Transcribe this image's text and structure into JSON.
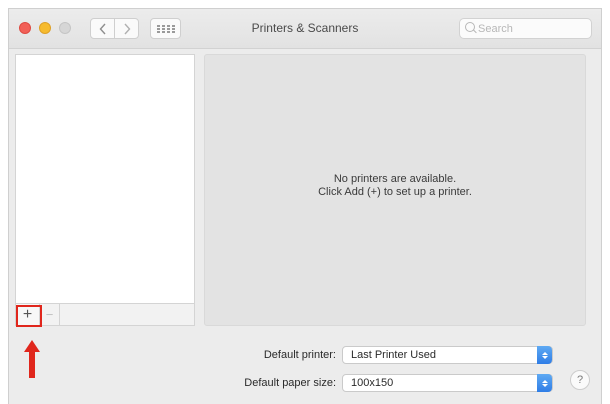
{
  "window": {
    "title": "Printers & Scanners",
    "search_placeholder": "Search"
  },
  "toolbar": {
    "back_icon": "chevron-left-icon",
    "forward_icon": "chevron-right-icon",
    "show_all_icon": "grid-icon"
  },
  "printer_list": {
    "items": [],
    "add_label": "+",
    "remove_label": "−"
  },
  "detail": {
    "message_line1": "No printers are available.",
    "message_line2": "Click Add (+) to set up a printer."
  },
  "settings": {
    "default_printer_label": "Default printer:",
    "default_printer_value": "Last Printer Used",
    "default_paper_label": "Default paper size:",
    "default_paper_value": "100x150"
  },
  "help": {
    "label": "?"
  },
  "annotation": {
    "color": "#e0261c"
  }
}
